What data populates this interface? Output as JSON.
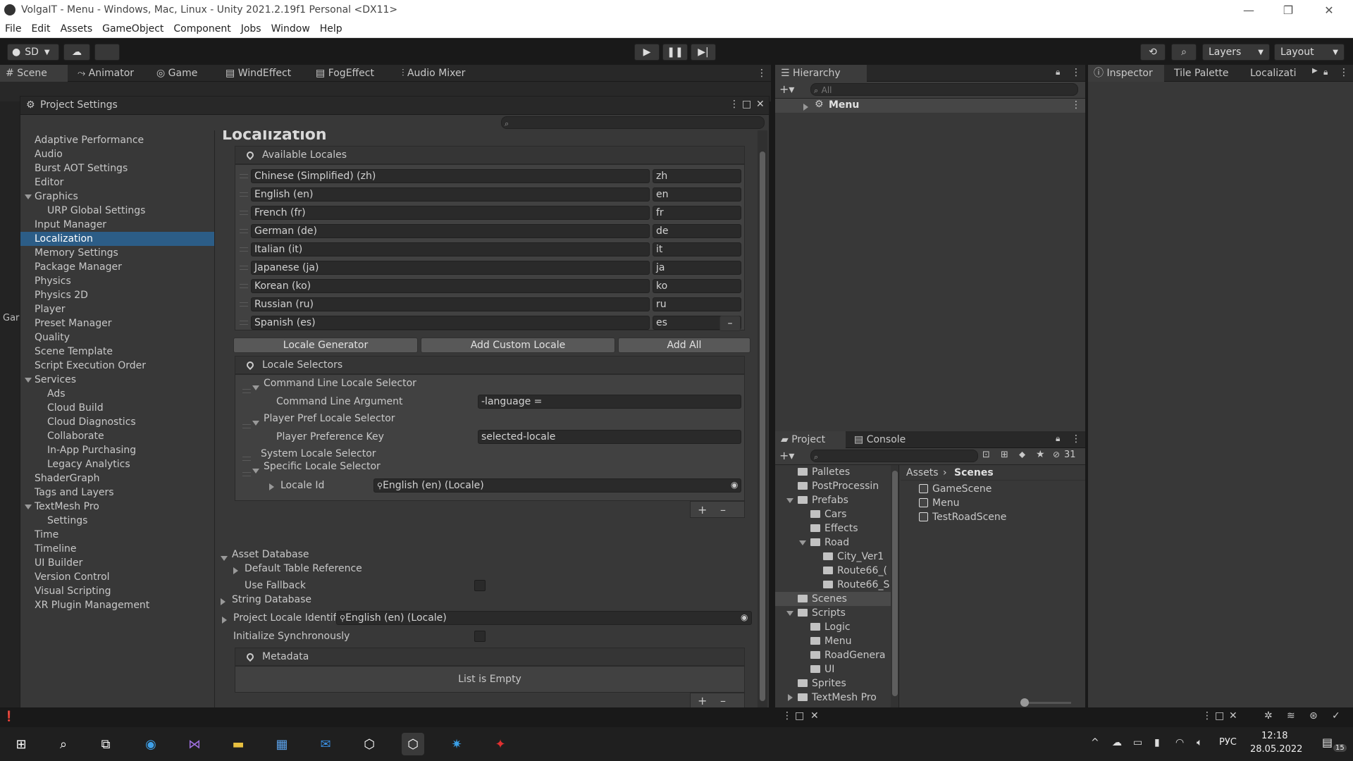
{
  "window": {
    "title": "VolgaIT - Menu - Windows, Mac, Linux - Unity 2021.2.19f1 Personal <DX11>",
    "controls": [
      "—",
      "❐",
      "✕"
    ]
  },
  "menubar": [
    "File",
    "Edit",
    "Assets",
    "GameObject",
    "Component",
    "Jobs",
    "Window",
    "Help"
  ],
  "toolbar": {
    "account": "SD",
    "layers": "Layers",
    "layout": "Layout"
  },
  "scene_tabs": [
    "Scene",
    "Animator",
    "Game",
    "WindEffect",
    "FogEffect",
    "Audio Mixer"
  ],
  "left_strip": {
    "game_label": "Gar"
  },
  "project_settings": {
    "title": "Project Settings",
    "search_placeholder": "",
    "nav": [
      {
        "label": "Adaptive Performance",
        "indent": 0
      },
      {
        "label": "Audio",
        "indent": 0
      },
      {
        "label": "Burst AOT Settings",
        "indent": 0
      },
      {
        "label": "Editor",
        "indent": 0
      },
      {
        "label": "Graphics",
        "indent": 0,
        "expanded": true
      },
      {
        "label": "URP Global Settings",
        "indent": 1
      },
      {
        "label": "Input Manager",
        "indent": 0
      },
      {
        "label": "Localization",
        "indent": 0,
        "selected": true
      },
      {
        "label": "Memory Settings",
        "indent": 0
      },
      {
        "label": "Package Manager",
        "indent": 0
      },
      {
        "label": "Physics",
        "indent": 0
      },
      {
        "label": "Physics 2D",
        "indent": 0
      },
      {
        "label": "Player",
        "indent": 0
      },
      {
        "label": "Preset Manager",
        "indent": 0
      },
      {
        "label": "Quality",
        "indent": 0
      },
      {
        "label": "Scene Template",
        "indent": 0
      },
      {
        "label": "Script Execution Order",
        "indent": 0
      },
      {
        "label": "Services",
        "indent": 0,
        "expanded": true
      },
      {
        "label": "Ads",
        "indent": 1
      },
      {
        "label": "Cloud Build",
        "indent": 1
      },
      {
        "label": "Cloud Diagnostics",
        "indent": 1
      },
      {
        "label": "Collaborate",
        "indent": 1
      },
      {
        "label": "In-App Purchasing",
        "indent": 1
      },
      {
        "label": "Legacy Analytics",
        "indent": 1
      },
      {
        "label": "ShaderGraph",
        "indent": 0
      },
      {
        "label": "Tags and Layers",
        "indent": 0
      },
      {
        "label": "TextMesh Pro",
        "indent": 0,
        "expanded": true
      },
      {
        "label": "Settings",
        "indent": 1
      },
      {
        "label": "Time",
        "indent": 0
      },
      {
        "label": "Timeline",
        "indent": 0
      },
      {
        "label": "UI Builder",
        "indent": 0
      },
      {
        "label": "Version Control",
        "indent": 0
      },
      {
        "label": "Visual Scripting",
        "indent": 0
      },
      {
        "label": "XR Plugin Management",
        "indent": 0
      }
    ],
    "content": {
      "heading": "Localization",
      "available_locales_title": "Available Locales",
      "locales": [
        {
          "name": "Chinese (Simplified) (zh)",
          "code": "zh"
        },
        {
          "name": "English (en)",
          "code": "en"
        },
        {
          "name": "French (fr)",
          "code": "fr"
        },
        {
          "name": "German (de)",
          "code": "de"
        },
        {
          "name": "Italian (it)",
          "code": "it"
        },
        {
          "name": "Japanese (ja)",
          "code": "ja"
        },
        {
          "name": "Korean (ko)",
          "code": "ko"
        },
        {
          "name": "Russian (ru)",
          "code": "ru"
        },
        {
          "name": "Spanish (es)",
          "code": "es"
        }
      ],
      "buttons": {
        "generator": "Locale Generator",
        "custom": "Add Custom Locale",
        "add_all": "Add All"
      },
      "selectors_title": "Locale Selectors",
      "cmd_selector": "Command Line Locale Selector",
      "cmd_arg_label": "Command Line Argument",
      "cmd_arg_value": "-language =",
      "pref_selector": "Player Pref Locale Selector",
      "pref_key_label": "Player Preference Key",
      "pref_key_value": "selected-locale",
      "system_selector": "System Locale Selector",
      "specific_selector": "Specific Locale Selector",
      "locale_id_label": "Locale Id",
      "locale_id_value": "English (en) (Locale)",
      "asset_db": "Asset Database",
      "default_table_ref": "Default Table Reference",
      "use_fallback": "Use Fallback",
      "string_db": "String Database",
      "project_locale_label": "Project Locale Identifier",
      "project_locale_value": "English (en) (Locale)",
      "init_sync": "Initialize Synchronously",
      "metadata_title": "Metadata",
      "list_empty": "List is Empty"
    }
  },
  "hierarchy": {
    "tab": "Hierarchy",
    "search_placeholder": "All",
    "root": "Menu"
  },
  "inspector_tabs": [
    "Inspector",
    "Tile Palette",
    "Localizati"
  ],
  "project": {
    "tabs": [
      "Project",
      "Console"
    ],
    "hidden_count": "31",
    "tree": [
      {
        "label": "Palletes",
        "indent": 1
      },
      {
        "label": "PostProcessin",
        "indent": 1
      },
      {
        "label": "Prefabs",
        "indent": 1,
        "expanded": true
      },
      {
        "label": "Cars",
        "indent": 2
      },
      {
        "label": "Effects",
        "indent": 2
      },
      {
        "label": "Road",
        "indent": 2,
        "expanded": true
      },
      {
        "label": "City_Ver1",
        "indent": 3
      },
      {
        "label": "Route66_(",
        "indent": 3
      },
      {
        "label": "Route66_S",
        "indent": 3
      },
      {
        "label": "Scenes",
        "indent": 1,
        "selected": true
      },
      {
        "label": "Scripts",
        "indent": 1,
        "expanded": true
      },
      {
        "label": "Logic",
        "indent": 2
      },
      {
        "label": "Menu",
        "indent": 2
      },
      {
        "label": "RoadGenera",
        "indent": 2
      },
      {
        "label": "UI",
        "indent": 2
      },
      {
        "label": "Sprites",
        "indent": 1
      },
      {
        "label": "TextMesh Pro",
        "indent": 1,
        "collapsed": true
      }
    ],
    "breadcrumb": [
      "Assets",
      "Scenes"
    ],
    "files": [
      "GameScene",
      "Menu",
      "TestRoadScene"
    ]
  },
  "taskbar": {
    "lang": "РУС",
    "time": "12:18",
    "date": "28.05.2022",
    "notif": "15"
  }
}
